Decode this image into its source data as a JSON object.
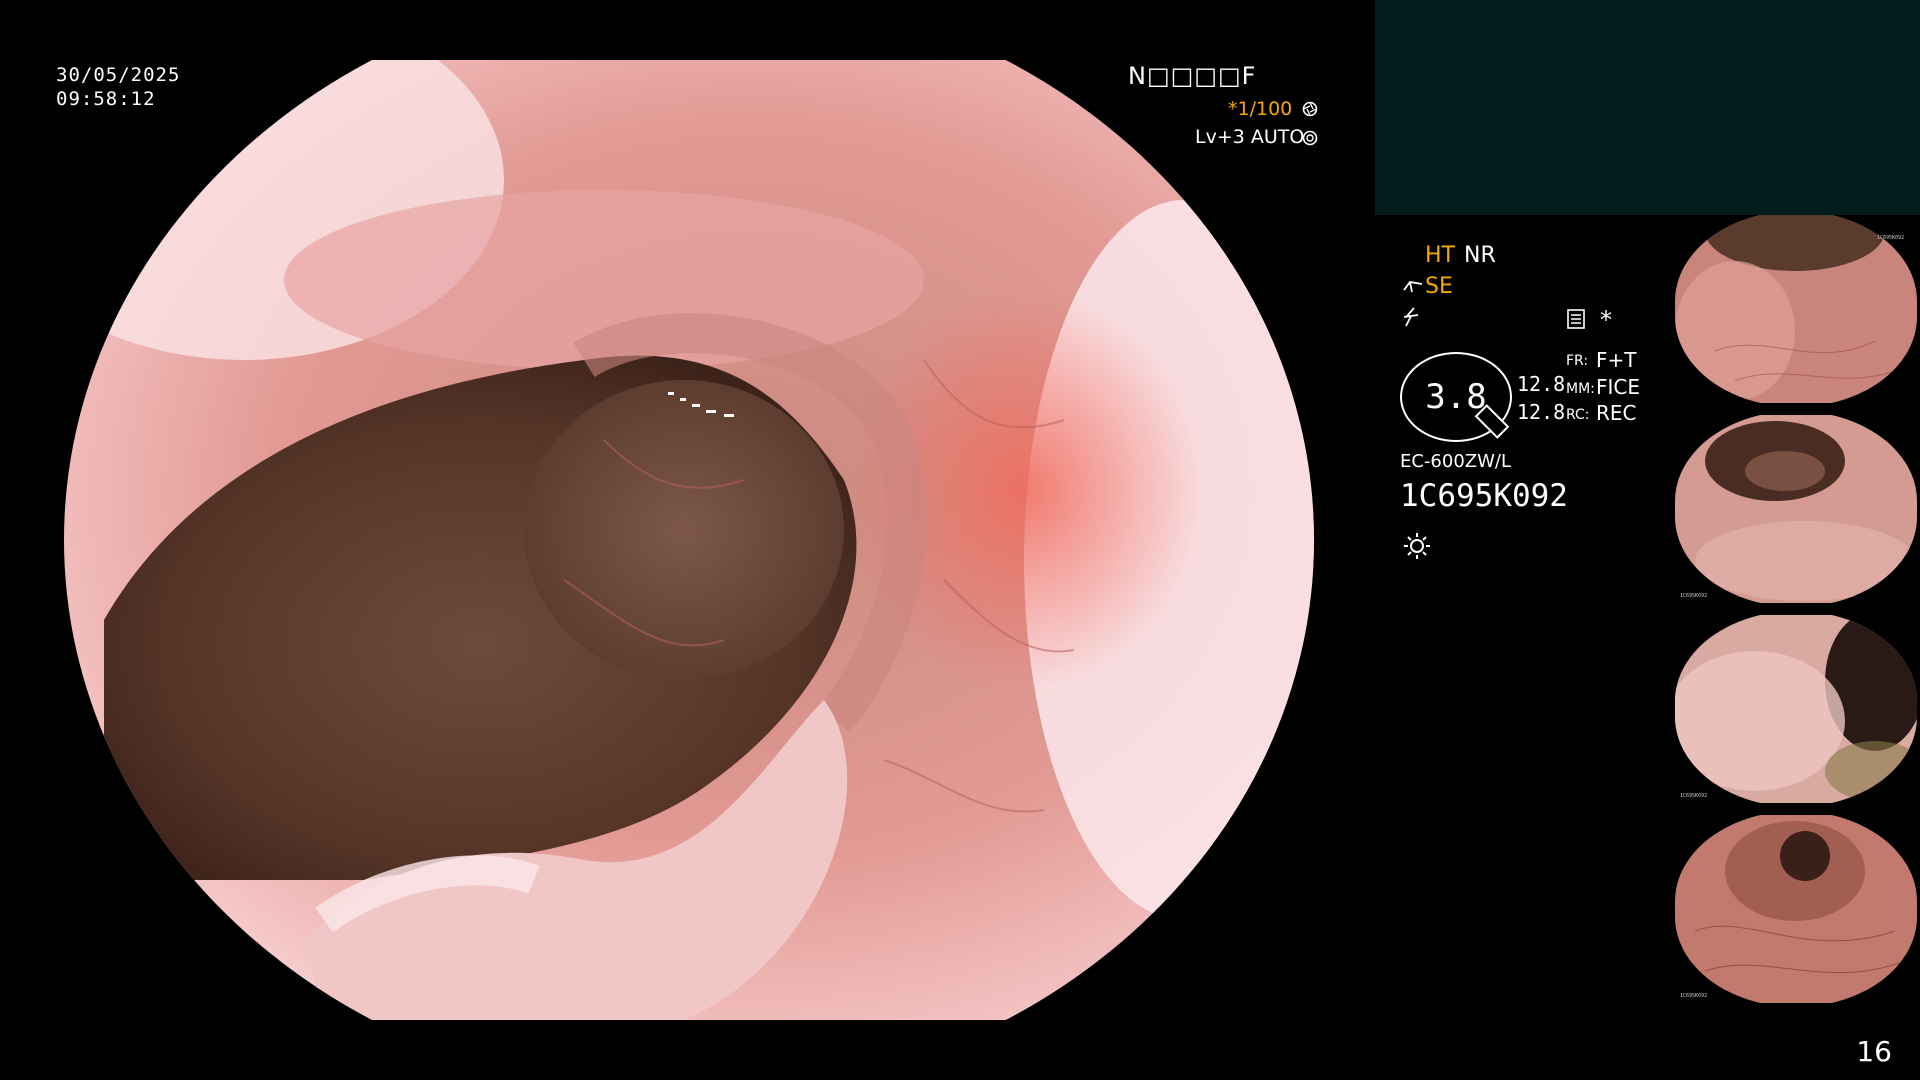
{
  "overlay": {
    "date": "30/05/2025",
    "time": "09:58:12",
    "patient_field": "N□□□□F",
    "shutter": "*1/100",
    "level": "Lv+3 AUTO",
    "enhance_ht": "HT",
    "enhance_nr": "NR",
    "se_label": "SE",
    "zoom_value": "3.8",
    "val_a": "12.8",
    "val_b": "12.8",
    "fr_label": "FR:",
    "fr_value": "F+T",
    "mm_label": "MM:",
    "mm_value": "FICE",
    "rc_label": "RC:",
    "rc_value": "REC",
    "scope_model": "EC-600ZW/L",
    "scope_serial": "1C695K092",
    "asterisk": "*",
    "page_number": "16"
  },
  "icons": {
    "shutter": "aperture-icon",
    "level": "iris-icon",
    "scope_angle": "scope-tip-icon",
    "freeze": "lightning-icon",
    "memory": "card-icon",
    "light": "sun-icon"
  },
  "colors": {
    "background": "#000000",
    "panel": "#021c1c",
    "accent_orange": "#f5a800",
    "text": "#ffffff"
  },
  "thumbnails": [
    {
      "serial": "1C695K092"
    },
    {
      "serial": "1C695K092"
    },
    {
      "serial": "1C695K092"
    },
    {
      "serial": "1C695K092"
    }
  ]
}
